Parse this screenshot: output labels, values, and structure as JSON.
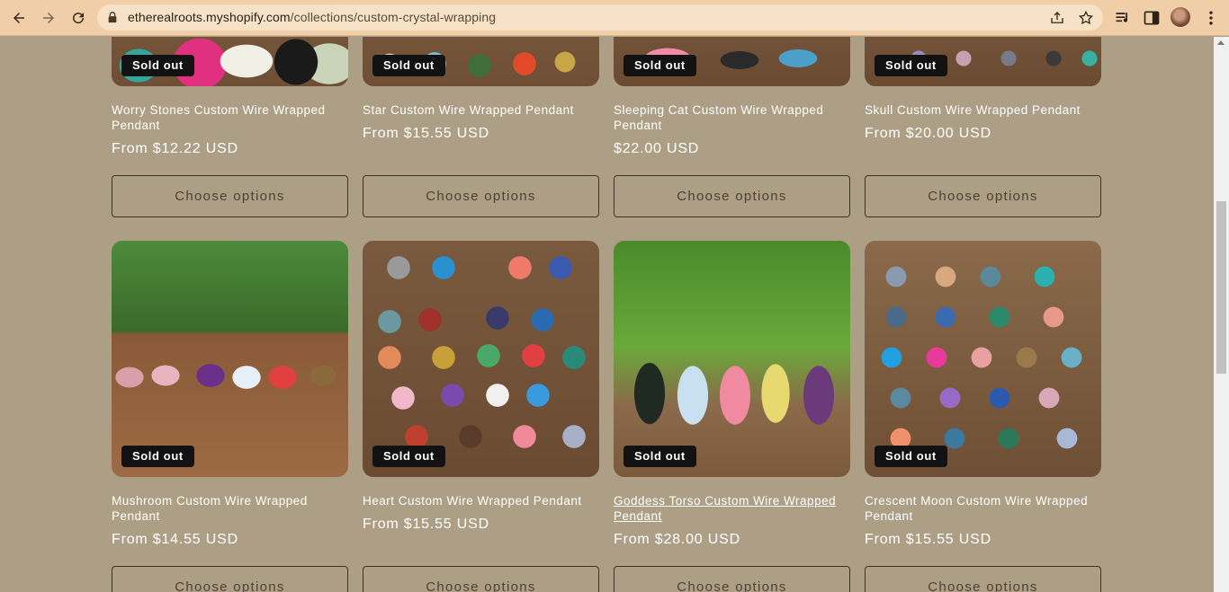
{
  "browser": {
    "url_domain": "etherealroots.myshopify.com",
    "url_path": "/collections/custom-crystal-wrapping",
    "back_icon": "arrow-left-icon",
    "forward_icon": "arrow-right-icon",
    "reload_icon": "reload-icon",
    "lock_icon": "lock-icon",
    "share_icon": "share-icon",
    "bookmark_icon": "star-icon",
    "media_icon": "media-queue-icon",
    "sidepanel_icon": "side-panel-icon",
    "menu_icon": "kebab-menu-icon"
  },
  "products": {
    "row1": [
      {
        "title": "Worry Stones Custom Wire Wrapped Pendant",
        "price": "From $12.22 USD",
        "badge": "Sold out",
        "button": "Choose options"
      },
      {
        "title": "Star Custom Wire Wrapped Pendant",
        "price": "From $15.55 USD",
        "badge": "Sold out",
        "button": "Choose options"
      },
      {
        "title": "Sleeping Cat Custom Wire Wrapped Pendant",
        "price": "$22.00 USD",
        "badge": "Sold out",
        "button": "Choose options"
      },
      {
        "title": "Skull Custom Wire Wrapped Pendant",
        "price": "From $20.00 USD",
        "badge": "Sold out",
        "button": "Choose options"
      }
    ],
    "row2": [
      {
        "title": "Mushroom Custom Wire Wrapped Pendant",
        "price": "From $14.55 USD",
        "badge": "Sold out",
        "button": "Choose options"
      },
      {
        "title": "Heart Custom Wire Wrapped Pendant",
        "price": "From $15.55 USD",
        "badge": "Sold out",
        "button": "Choose options"
      },
      {
        "title": "Goddess Torso Custom Wire Wrapped Pendant",
        "price": "From $28.00 USD",
        "badge": "Sold out",
        "button": "Choose options"
      },
      {
        "title": "Crescent Moon Custom Wire Wrapped Pendant",
        "price": "From $15.55 USD",
        "badge": "Sold out",
        "button": "Choose options"
      }
    ]
  },
  "colors": {
    "page_bg": "#ad9f85",
    "chrome_bg": "#f0cfa8",
    "badge_bg": "#121212",
    "button_border": "#3e3529"
  }
}
